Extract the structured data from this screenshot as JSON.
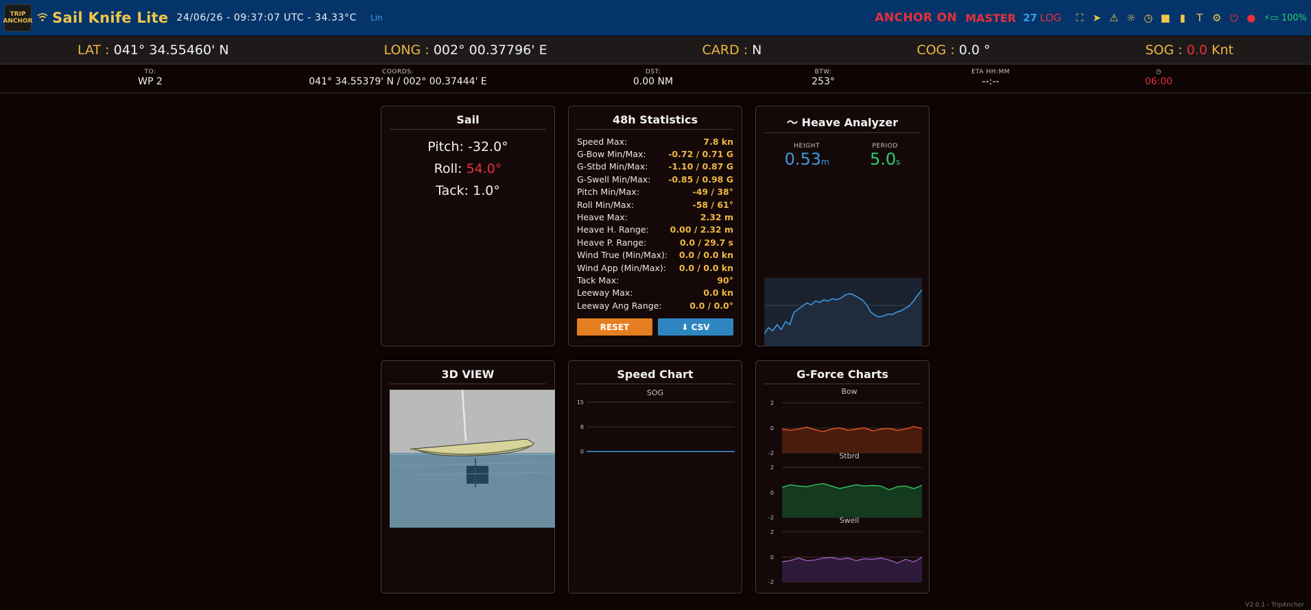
{
  "header": {
    "app_title": "Sail Knife Lite",
    "logo_text": "TRIP ANCHOR",
    "clock": "24/06/26 - 09:37:07 UTC - 34.33°C",
    "lin": "Lin",
    "anchor": "ANCHOR ON",
    "master": "MASTER",
    "count": "27",
    "log": "LOG",
    "battery": "100%",
    "icons": [
      "fullscreen-icon",
      "navigation-icon",
      "warning-icon",
      "brightness-icon",
      "clock-icon",
      "folder-icon",
      "sd-card-icon",
      "text-icon",
      "gear-icon",
      "power-icon",
      "record-dot-icon",
      "battery-icon"
    ]
  },
  "nav": {
    "lat": {
      "label": "LAT",
      "value": "041° 34.55460' N"
    },
    "long": {
      "label": "LONG",
      "value": "002° 00.37796' E"
    },
    "card": {
      "label": "CARD",
      "value": "N"
    },
    "cog": {
      "label": "COG",
      "value": "0.0 °"
    },
    "sog": {
      "label": "SOG",
      "value": "0.0",
      "unit": "Knt"
    }
  },
  "waypoint": {
    "to": {
      "label": "TO:",
      "value": "WP 2"
    },
    "coords": {
      "label": "COORDS:",
      "value": "041° 34.55379' N / 002° 00.37444' E"
    },
    "dst": {
      "label": "DST:",
      "value": "0.00 NM"
    },
    "btw": {
      "label": "BTW:",
      "value": "253°"
    },
    "eta": {
      "label": "ETA HH:MM",
      "value": "--:--"
    },
    "timer": {
      "label": "◷",
      "value": "06:00"
    }
  },
  "sail": {
    "title": "Sail",
    "pitch_label": "Pitch:",
    "pitch": "-32.0°",
    "roll_label": "Roll:",
    "roll": "54.0°",
    "tack_label": "Tack:",
    "tack": "1.0°"
  },
  "stats": {
    "title": "48h Statistics",
    "rows": [
      {
        "k": "Speed Max:",
        "v": "7.8 kn"
      },
      {
        "k": "G-Bow Min/Max:",
        "v": "-0.72 / 0.71 G"
      },
      {
        "k": "G-Stbd Min/Max:",
        "v": "-1.10 / 0.87 G"
      },
      {
        "k": "G-Swell Min/Max:",
        "v": "-0.85 / 0.98 G"
      },
      {
        "k": "Pitch Min/Max:",
        "v": "-49 / 38°"
      },
      {
        "k": "Roll Min/Max:",
        "v": "-58 / 61°"
      },
      {
        "k": "Heave Max:",
        "v": "2.32 m"
      },
      {
        "k": "Heave H. Range:",
        "v": "0.00 / 2.32 m"
      },
      {
        "k": "Heave P. Range:",
        "v": "0.0 / 29.7 s"
      },
      {
        "k": "Wind True (Min/Max):",
        "v": "0.0 / 0.0 kn"
      },
      {
        "k": "Wind App (Min/Max):",
        "v": "0.0 / 0.0 kn"
      },
      {
        "k": "Tack Max:",
        "v": "90°"
      },
      {
        "k": "Leeway Max:",
        "v": "0.0 kn"
      },
      {
        "k": "Leeway Ang Range:",
        "v": "0.0 / 0.0°"
      }
    ],
    "reset_label": "RESET",
    "csv_label": "⬇ CSV"
  },
  "heave": {
    "title": "〜 Heave Analyzer",
    "height_label": "HEIGHT",
    "height": "0.53",
    "height_unit": "m",
    "period_label": "PERIOD",
    "period": "5.0",
    "period_unit": "s"
  },
  "view3d": {
    "title": "3D VIEW"
  },
  "speed_chart": {
    "title": "Speed Chart",
    "subtitle": "SOG",
    "ticks": [
      "15",
      "8",
      "0"
    ]
  },
  "gforce": {
    "title": "G-Force Charts",
    "charts": [
      {
        "name": "Bow",
        "ticks": [
          "2",
          "0",
          "-2"
        ]
      },
      {
        "name": "Stbrd",
        "ticks": [
          "2",
          "0",
          "-2"
        ]
      },
      {
        "name": "Swell",
        "ticks": [
          "2",
          "0",
          "-2"
        ]
      }
    ]
  },
  "chart_data": [
    {
      "type": "area",
      "title": "",
      "series": [
        {
          "values": [
            0.15,
            0.25,
            0.2,
            0.3,
            0.22,
            0.35,
            0.3,
            0.5,
            0.55,
            0.6,
            0.65,
            0.62,
            0.68,
            0.66,
            0.7,
            0.68,
            0.72,
            0.7,
            0.73,
            0.78,
            0.8,
            0.78,
            0.74,
            0.7,
            0.62,
            0.5,
            0.45,
            0.42,
            0.44,
            0.47,
            0.46,
            0.5,
            0.52,
            0.56,
            0.6,
            0.68,
            0.78,
            0.86
          ]
        }
      ],
      "ylim": [
        0,
        1
      ]
    },
    {
      "type": "line",
      "title": "Speed Chart",
      "series": [
        {
          "name": "SOG",
          "values": [
            0,
            0,
            0,
            0,
            0,
            0,
            0,
            0,
            0,
            0
          ]
        }
      ],
      "ylim": [
        0,
        15
      ]
    },
    {
      "type": "area",
      "title": "Bow",
      "series": [
        {
          "name": "Bow",
          "values": [
            -0.1,
            -0.2,
            -0.1,
            0.05,
            -0.15,
            -0.3,
            -0.1,
            0.0,
            -0.2,
            -0.1,
            0.0,
            -0.25,
            -0.1,
            -0.05,
            -0.2,
            -0.1,
            0.1,
            -0.05
          ]
        }
      ],
      "ylim": [
        -2,
        2
      ]
    },
    {
      "type": "area",
      "title": "Stbrd",
      "series": [
        {
          "name": "Stbrd",
          "values": [
            0.4,
            0.6,
            0.5,
            0.45,
            0.6,
            0.7,
            0.5,
            0.3,
            0.45,
            0.6,
            0.5,
            0.55,
            0.5,
            0.2,
            0.45,
            0.5,
            0.3,
            0.55
          ]
        }
      ],
      "ylim": [
        -2,
        2
      ]
    },
    {
      "type": "area",
      "title": "Swell",
      "series": [
        {
          "name": "Swell",
          "values": [
            -0.4,
            -0.3,
            -0.1,
            -0.3,
            -0.25,
            -0.1,
            -0.05,
            -0.2,
            -0.1,
            -0.3,
            -0.15,
            -0.2,
            -0.1,
            -0.25,
            -0.5,
            -0.2,
            -0.4,
            -0.05
          ]
        }
      ],
      "ylim": [
        -2,
        2
      ]
    }
  ],
  "colors": {
    "accent": "#f0b743",
    "alert": "#e8303a",
    "blue": "#3d9be0",
    "green": "#2ecc71",
    "bow": "#e0531f",
    "stbrd": "#2fbf5a",
    "swell": "#9b59b6"
  },
  "footer": "V2.0.1 - TripAnchor"
}
